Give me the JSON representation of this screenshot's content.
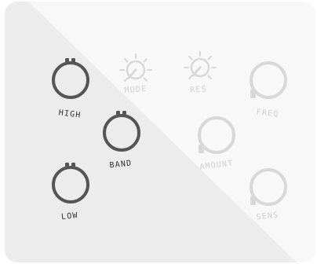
{
  "controls": {
    "high": {
      "label": "HIGH"
    },
    "band": {
      "label": "BAND"
    },
    "low": {
      "label": "LOW"
    },
    "mode": {
      "label": "MODE"
    },
    "res": {
      "label": "RES"
    },
    "freq": {
      "label": "FREQ"
    },
    "amount": {
      "label": "AMOUNT"
    },
    "sens": {
      "label": "SENS"
    }
  },
  "colors": {
    "panel_light": "#f8f8f8",
    "panel_shade": "#ececec",
    "knob_active": "#555555",
    "knob_inactive": "#d8d8d8"
  }
}
